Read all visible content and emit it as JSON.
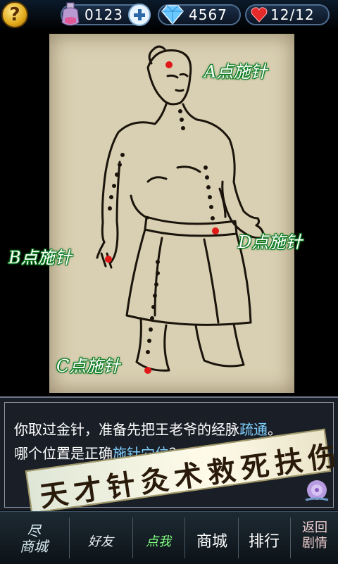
{
  "topbar": {
    "help_label": "?",
    "potion_count": "0123",
    "gem_count": "4567",
    "health": "12/12",
    "icons": [
      "help-icon",
      "potion-icon",
      "plus-icon",
      "diamond-icon",
      "heart-icon"
    ]
  },
  "labels": {
    "a": "A点施针",
    "b": "B点施针",
    "c": "C点施针",
    "d": "D点施针"
  },
  "dialog": {
    "line1_a": "你取过金针，准备先把王老爷的经脉",
    "line1_hl": "疏通",
    "line1_b": "。",
    "line2_a": "哪个位置是正确",
    "line2_hl": "施针穴位",
    "line2_b": "？"
  },
  "banner": "天才针灸术救死扶伤",
  "bottom_nav": {
    "mall_top": "尽",
    "mall": "商城",
    "friends": "好友",
    "click_me": "点我",
    "shop": "商城",
    "rank": "排行",
    "back_top": "返回",
    "back_bottom": "剧情"
  },
  "colors": {
    "label_outline": "#0a7a1f",
    "acupoint": "#e01818",
    "highlight": "#7fd0ff"
  }
}
